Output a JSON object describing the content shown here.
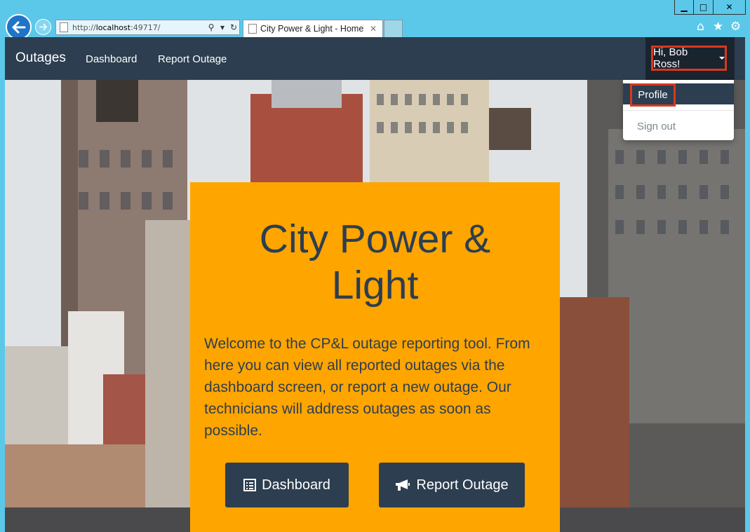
{
  "browser": {
    "window_controls": {
      "minimize": "▁",
      "maximize": "□",
      "close": "✕"
    },
    "url_prefix": "http://",
    "url_host": "localhost",
    "url_suffix": ":49717/",
    "tab_title": "City Power & Light - Home",
    "icons": [
      "back-icon",
      "forward-icon",
      "search-icon",
      "refresh-icon",
      "home-icon",
      "favorites-icon",
      "settings-icon"
    ]
  },
  "navbar": {
    "brand": "Outages",
    "links": [
      "Dashboard",
      "Report Outage"
    ],
    "user_greeting": "Hi, Bob Ross!"
  },
  "user_menu": {
    "profile": "Profile",
    "sign_out": "Sign out"
  },
  "jumbotron": {
    "title_line1": "City Power &",
    "title_line2": "Light",
    "welcome": "Welcome to the CP&L outage reporting tool. From here you can view all reported outages via the dashboard screen, or report a new outage. Our technicians will address outages as soon as possible.",
    "btn_dashboard": "Dashboard",
    "btn_report": "Report Outage"
  },
  "colors": {
    "navbar": "#2c3e50",
    "accent": "#ffa500",
    "highlight": "#d9381e",
    "browser_frame": "#5bc8ea"
  }
}
